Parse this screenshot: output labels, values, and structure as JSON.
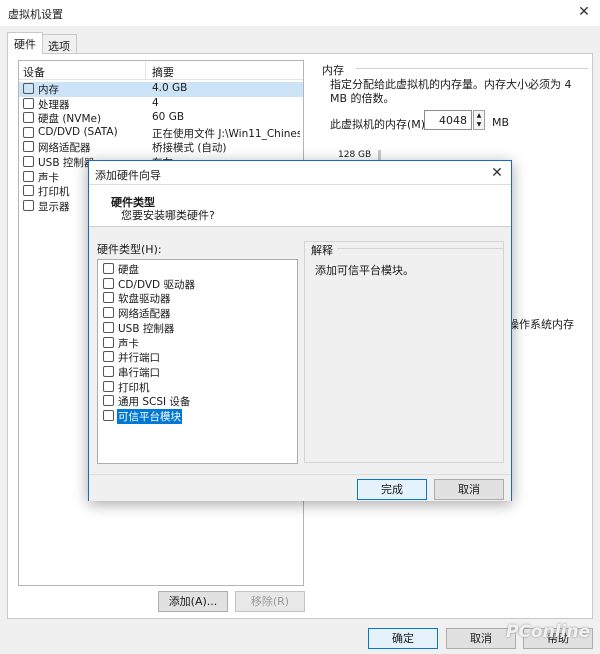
{
  "window": {
    "title": "虚拟机设置",
    "close": "✕"
  },
  "tabs": [
    {
      "label": "硬件"
    },
    {
      "label": "选项"
    }
  ],
  "device_list": {
    "headers": {
      "device": "设备",
      "summary": "摘要"
    },
    "rows": [
      {
        "name": "内存",
        "value": "4.0 GB",
        "icon": "memory-icon"
      },
      {
        "name": "处理器",
        "value": "4",
        "icon": "cpu-icon"
      },
      {
        "name": "硬盘 (NVMe)",
        "value": "60 GB",
        "icon": "disk-icon"
      },
      {
        "name": "CD/DVD (SATA)",
        "value": "正在使用文件 J:\\Win11_Chines...",
        "icon": "cd-icon"
      },
      {
        "name": "网络适配器",
        "value": "桥接模式 (自动)",
        "icon": "network-icon"
      },
      {
        "name": "USB 控制器",
        "value": "存在",
        "icon": "usb-icon"
      },
      {
        "name": "声卡",
        "value": "",
        "icon": "sound-icon"
      },
      {
        "name": "打印机",
        "value": "",
        "icon": "printer-icon"
      },
      {
        "name": "显示器",
        "value": "",
        "icon": "display-icon"
      }
    ]
  },
  "memory": {
    "title": "内存",
    "description": "指定分配给此虚拟机的内存量。内存大小必须为 4 MB 的倍数。",
    "label": "此虚拟机的内存(M):",
    "value": "4048",
    "unit": "MB",
    "tick": "128 GB",
    "guest_text": "操作系统内存"
  },
  "buttons": {
    "add": "添加(A)...",
    "remove": "移除(R)",
    "ok": "确定",
    "cancel": "取消",
    "help": "帮助"
  },
  "watermark": "PConline",
  "dialog": {
    "title": "添加硬件向导",
    "close": "✕",
    "header_title": "硬件类型",
    "header_subtitle": "您要安装哪类硬件?",
    "list_label": "硬件类型(H):",
    "items": [
      {
        "label": "硬盘",
        "icon": "disk-icon"
      },
      {
        "label": "CD/DVD 驱动器",
        "icon": "cd-icon"
      },
      {
        "label": "软盘驱动器",
        "icon": "floppy-icon"
      },
      {
        "label": "网络适配器",
        "icon": "network-icon"
      },
      {
        "label": "USB 控制器",
        "icon": "usb-icon"
      },
      {
        "label": "声卡",
        "icon": "sound-icon"
      },
      {
        "label": "并行端口",
        "icon": "parallel-port-icon"
      },
      {
        "label": "串行端口",
        "icon": "serial-port-icon"
      },
      {
        "label": "打印机",
        "icon": "printer-icon"
      },
      {
        "label": "通用 SCSI 设备",
        "icon": "scsi-icon"
      },
      {
        "label": "可信平台模块",
        "icon": "tpm-icon"
      }
    ],
    "selected_index": 10,
    "explain_title": "解释",
    "explain_text": "添加可信平台模块。",
    "done": "完成",
    "cancel": "取消"
  }
}
